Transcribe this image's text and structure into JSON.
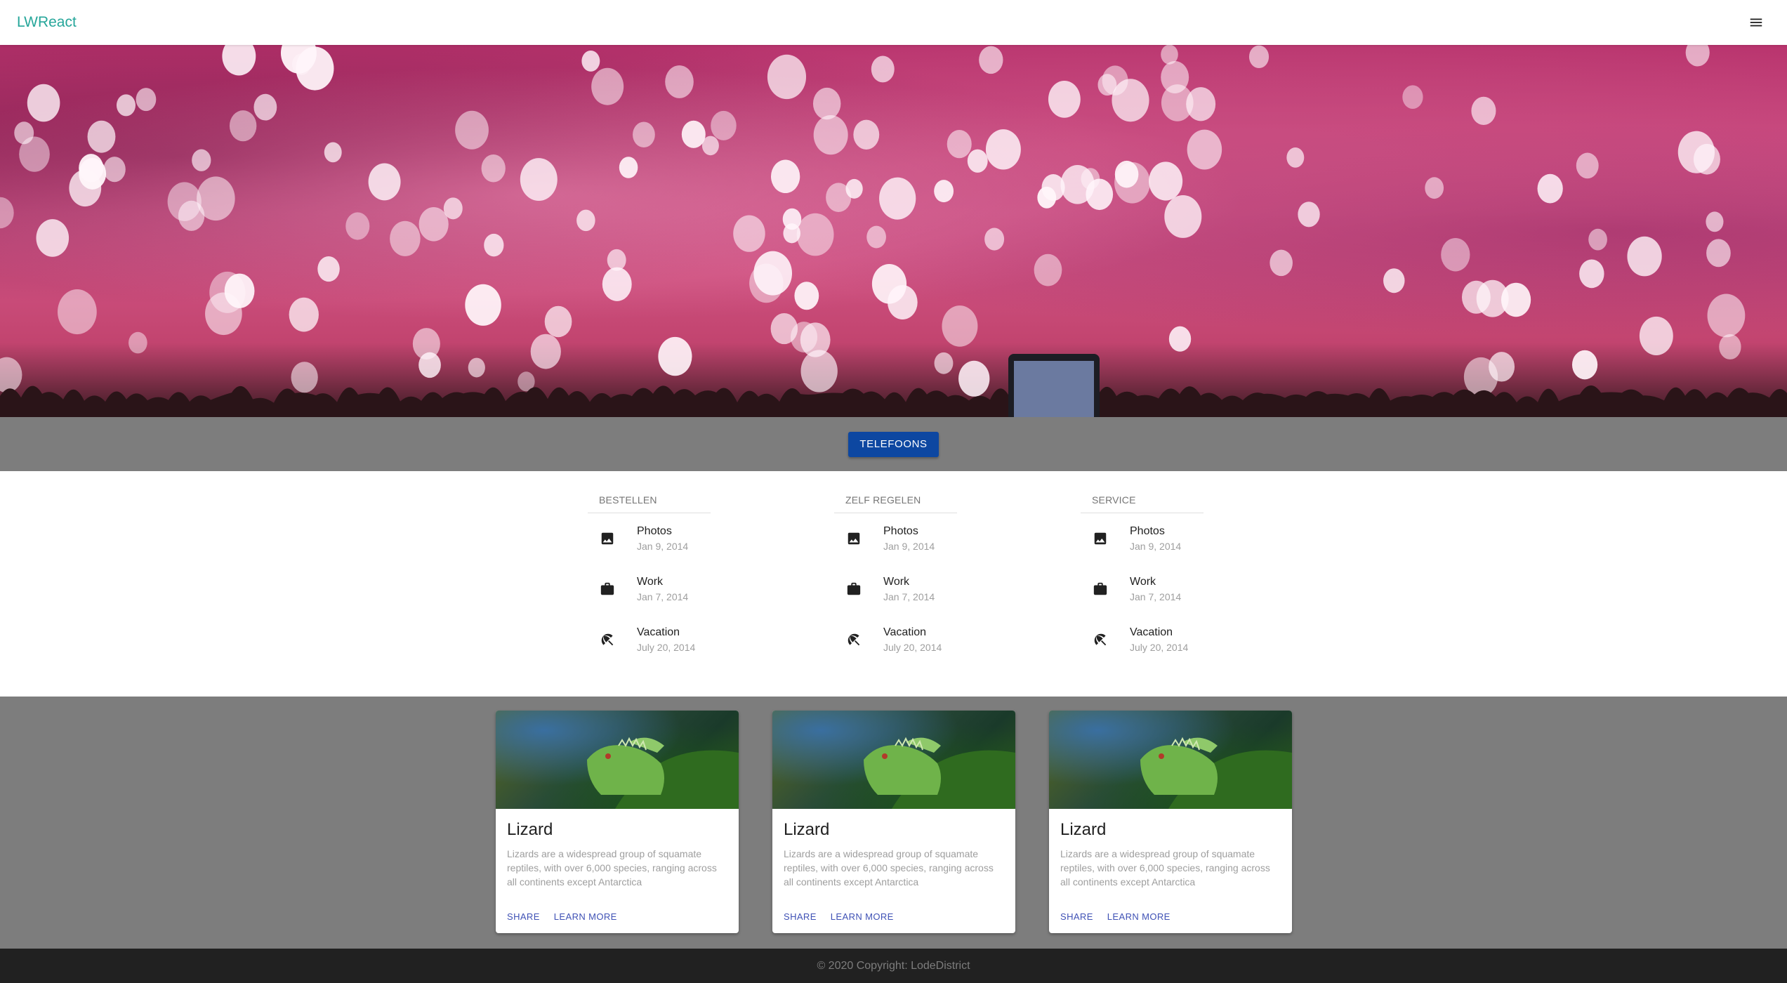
{
  "appbar": {
    "brand": "LWReact",
    "menu_icon": "hamburger-menu-icon"
  },
  "hero": {
    "image": "concert-crowd-bokeh-photo"
  },
  "band": {
    "button_label": "TELEFOONS",
    "button_color": "#0d47a1"
  },
  "lists": [
    {
      "title": "BESTELLEN",
      "items": [
        {
          "icon": "image-icon",
          "primary": "Photos",
          "secondary": "Jan 9, 2014"
        },
        {
          "icon": "work-icon",
          "primary": "Work",
          "secondary": "Jan 7, 2014"
        },
        {
          "icon": "beach-umbrella-icon",
          "primary": "Vacation",
          "secondary": "July 20, 2014"
        }
      ]
    },
    {
      "title": "ZELF REGELEN",
      "items": [
        {
          "icon": "image-icon",
          "primary": "Photos",
          "secondary": "Jan 9, 2014"
        },
        {
          "icon": "work-icon",
          "primary": "Work",
          "secondary": "Jan 7, 2014"
        },
        {
          "icon": "beach-umbrella-icon",
          "primary": "Vacation",
          "secondary": "July 20, 2014"
        }
      ]
    },
    {
      "title": "SERVICE",
      "items": [
        {
          "icon": "image-icon",
          "primary": "Photos",
          "secondary": "Jan 9, 2014"
        },
        {
          "icon": "work-icon",
          "primary": "Work",
          "secondary": "Jan 7, 2014"
        },
        {
          "icon": "beach-umbrella-icon",
          "primary": "Vacation",
          "secondary": "July 20, 2014"
        }
      ]
    }
  ],
  "cards": [
    {
      "title": "Lizard",
      "text": "Lizards are a widespread group of squamate reptiles, with over 6,000 species, ranging across all continents except Antarctica",
      "share": "SHARE",
      "learn_more": "LEARN MORE"
    },
    {
      "title": "Lizard",
      "text": "Lizards are a widespread group of squamate reptiles, with over 6,000 species, ranging across all continents except Antarctica",
      "share": "SHARE",
      "learn_more": "LEARN MORE"
    },
    {
      "title": "Lizard",
      "text": "Lizards are a widespread group of squamate reptiles, with over 6,000 species, ranging across all continents except Antarctica",
      "share": "SHARE",
      "learn_more": "LEARN MORE"
    }
  ],
  "footer": {
    "copyright": "© 2020 Copyright: LodeDistrict"
  },
  "colors": {
    "brand": "#26a69a",
    "band_gray": "#7d7d7d",
    "footer_bg": "#212121",
    "link": "#3f51b5"
  }
}
